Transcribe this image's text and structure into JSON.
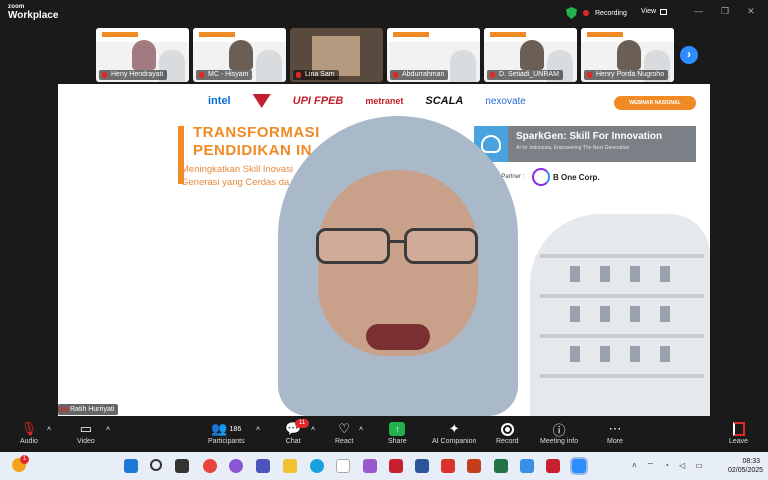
{
  "app": {
    "brand_top": "zoom",
    "brand_bottom": "Workplace"
  },
  "titlebar": {
    "recording_label": "Recording",
    "view_label": "View"
  },
  "gallery": {
    "participants": [
      {
        "name": "Heny Hendrayati"
      },
      {
        "name": "MC - Hisyam"
      },
      {
        "name": "Lina Sam"
      },
      {
        "name": "Abdurrahman"
      },
      {
        "name": "D. Setiadi_UNRAM"
      },
      {
        "name": "Henry Porda Nugroho"
      }
    ]
  },
  "slide": {
    "logos": [
      "intel",
      "UPI",
      "FPEB",
      "metranet",
      "SCALA",
      "nexovate"
    ],
    "webinar_badge": "WEBINAR NASIONAL",
    "title_line1": "TRANSFORMASI",
    "title_line2": "PENDIDIKAN IN",
    "subtitle_line1": "Meningkatkan Skill Inovasi",
    "subtitle_line2": "Generasi yang Cerdas da",
    "spark_title": "SparkGen: Skill For Innovation",
    "spark_tagline": "AI for Indonesia, Empowering The Next Generation",
    "license_label": "License Partner :",
    "partner_name": "B One Corp."
  },
  "speaker": {
    "name": "Ratih Hurriyati"
  },
  "toolbar": {
    "audio": "Audio",
    "video": "Video",
    "participants": "Participants",
    "participants_count": "186",
    "chat": "Chat",
    "chat_badge": "11",
    "react": "React",
    "share": "Share",
    "ai_companion": "AI Companion",
    "record": "Record",
    "meeting_info": "Meeting info",
    "more": "More",
    "leave": "Leave"
  },
  "taskbar": {
    "time": "08:33",
    "date": "02/05/2025",
    "weather_badge": "1"
  },
  "colors": {
    "accent_orange": "#f08a24",
    "zoom_blue": "#2d8cff",
    "record_red": "#e02828",
    "share_green": "#23b14d"
  }
}
